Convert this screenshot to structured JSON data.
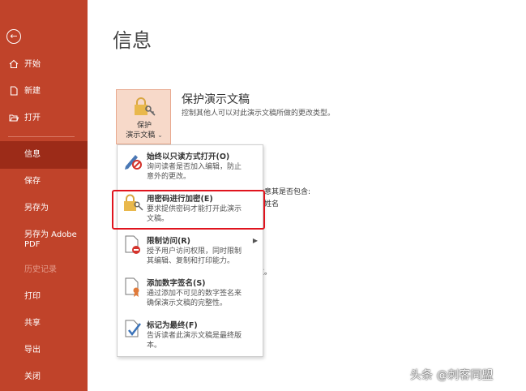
{
  "sidebar": {
    "items": [
      {
        "label": "开始",
        "icon": "home-icon"
      },
      {
        "label": "新建",
        "icon": "new-doc-icon"
      },
      {
        "label": "打开",
        "icon": "open-folder-icon"
      },
      {
        "label": "信息"
      },
      {
        "label": "保存"
      },
      {
        "label": "另存为"
      },
      {
        "label": "另存为 Adobe"
      },
      {
        "label": "PDF"
      },
      {
        "label": "历史记录"
      },
      {
        "label": "打印"
      },
      {
        "label": "共享"
      },
      {
        "label": "导出"
      },
      {
        "label": "关闭"
      }
    ]
  },
  "main": {
    "title": "信息",
    "protect": {
      "button_line1": "保护",
      "button_line2": "演示文稿",
      "dropdown_arrow": "⌄",
      "heading": "保护演示文稿",
      "description": "控制其他人可以对此演示文稿所做的更改类型。"
    },
    "background_fragments": [
      "注意其是否包含:",
      "姓名",
      "改。"
    ]
  },
  "menu": {
    "items": [
      {
        "title": "始终以只读方式打开(O)",
        "desc": [
          "询问读者是否加入编辑，防止",
          "意外的更改。"
        ]
      },
      {
        "title": "用密码进行加密(E)",
        "desc": [
          "要求提供密码才能打开此演示",
          "文稿。"
        ]
      },
      {
        "title": "限制访问(R)",
        "desc": [
          "授予用户访问权限，同时限制",
          "其编辑、复制和打印能力。"
        ]
      },
      {
        "title": "添加数字签名(S)",
        "desc": [
          "通过添加不可见的数字签名来",
          "确保演示文稿的完整性。"
        ]
      },
      {
        "title": "标记为最终(F)",
        "desc": [
          "告诉读者此演示文稿是最终版",
          "本。"
        ]
      }
    ]
  },
  "watermark": "头条 @刺客同盟",
  "colors": {
    "sidebar": "#c0432a",
    "sidebar_active": "#9c2b18",
    "highlight": "#e0141e"
  }
}
